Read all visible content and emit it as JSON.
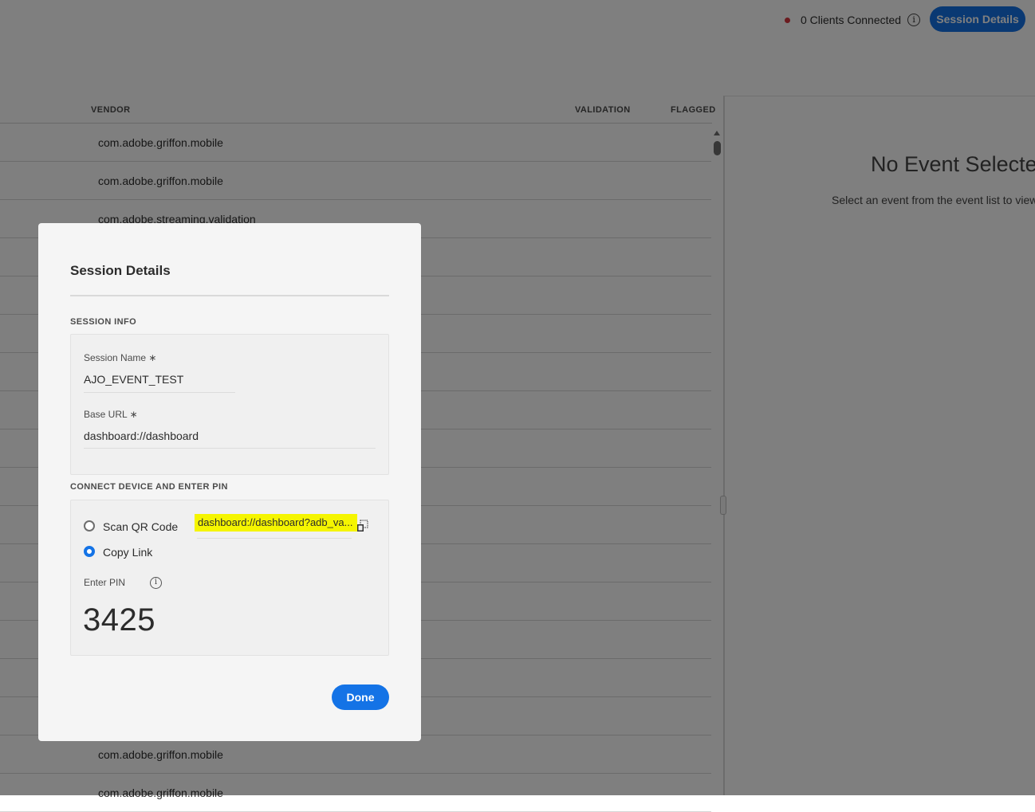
{
  "header": {
    "status_text": "0 Clients Connected",
    "status_color": "#d7373f",
    "session_button": "Session Details",
    "accent": "#1473e6"
  },
  "table": {
    "columns": [
      "VENDOR",
      "VALIDATION",
      "FLAGGED"
    ],
    "rows": [
      "com.adobe.griffon.mobile",
      "com.adobe.griffon.mobile",
      "com.adobe.streaming.validation",
      "",
      "",
      "",
      "",
      "",
      "",
      "",
      "",
      "",
      "",
      "",
      "",
      "",
      "com.adobe.griffon.mobile",
      "com.adobe.griffon.mobile"
    ]
  },
  "details_panel": {
    "title": "No Event Selected",
    "subtitle": "Select an event from the event list to view its"
  },
  "modal": {
    "title": "Session Details",
    "session_info_label": "SESSION INFO",
    "session_name_label": "Session Name ∗",
    "session_name_value": "AJO_EVENT_TEST",
    "base_url_label": "Base URL ∗",
    "base_url_value": "dashboard://dashboard",
    "connect_label": "CONNECT DEVICE AND ENTER PIN",
    "option_qr": "Scan QR Code",
    "option_link": "Copy Link",
    "selected_option": "Copy Link",
    "link_value": "dashboard://dashboard?adb_va...",
    "enter_pin_label": "Enter PIN",
    "pin": "3425",
    "done_button": "Done"
  }
}
